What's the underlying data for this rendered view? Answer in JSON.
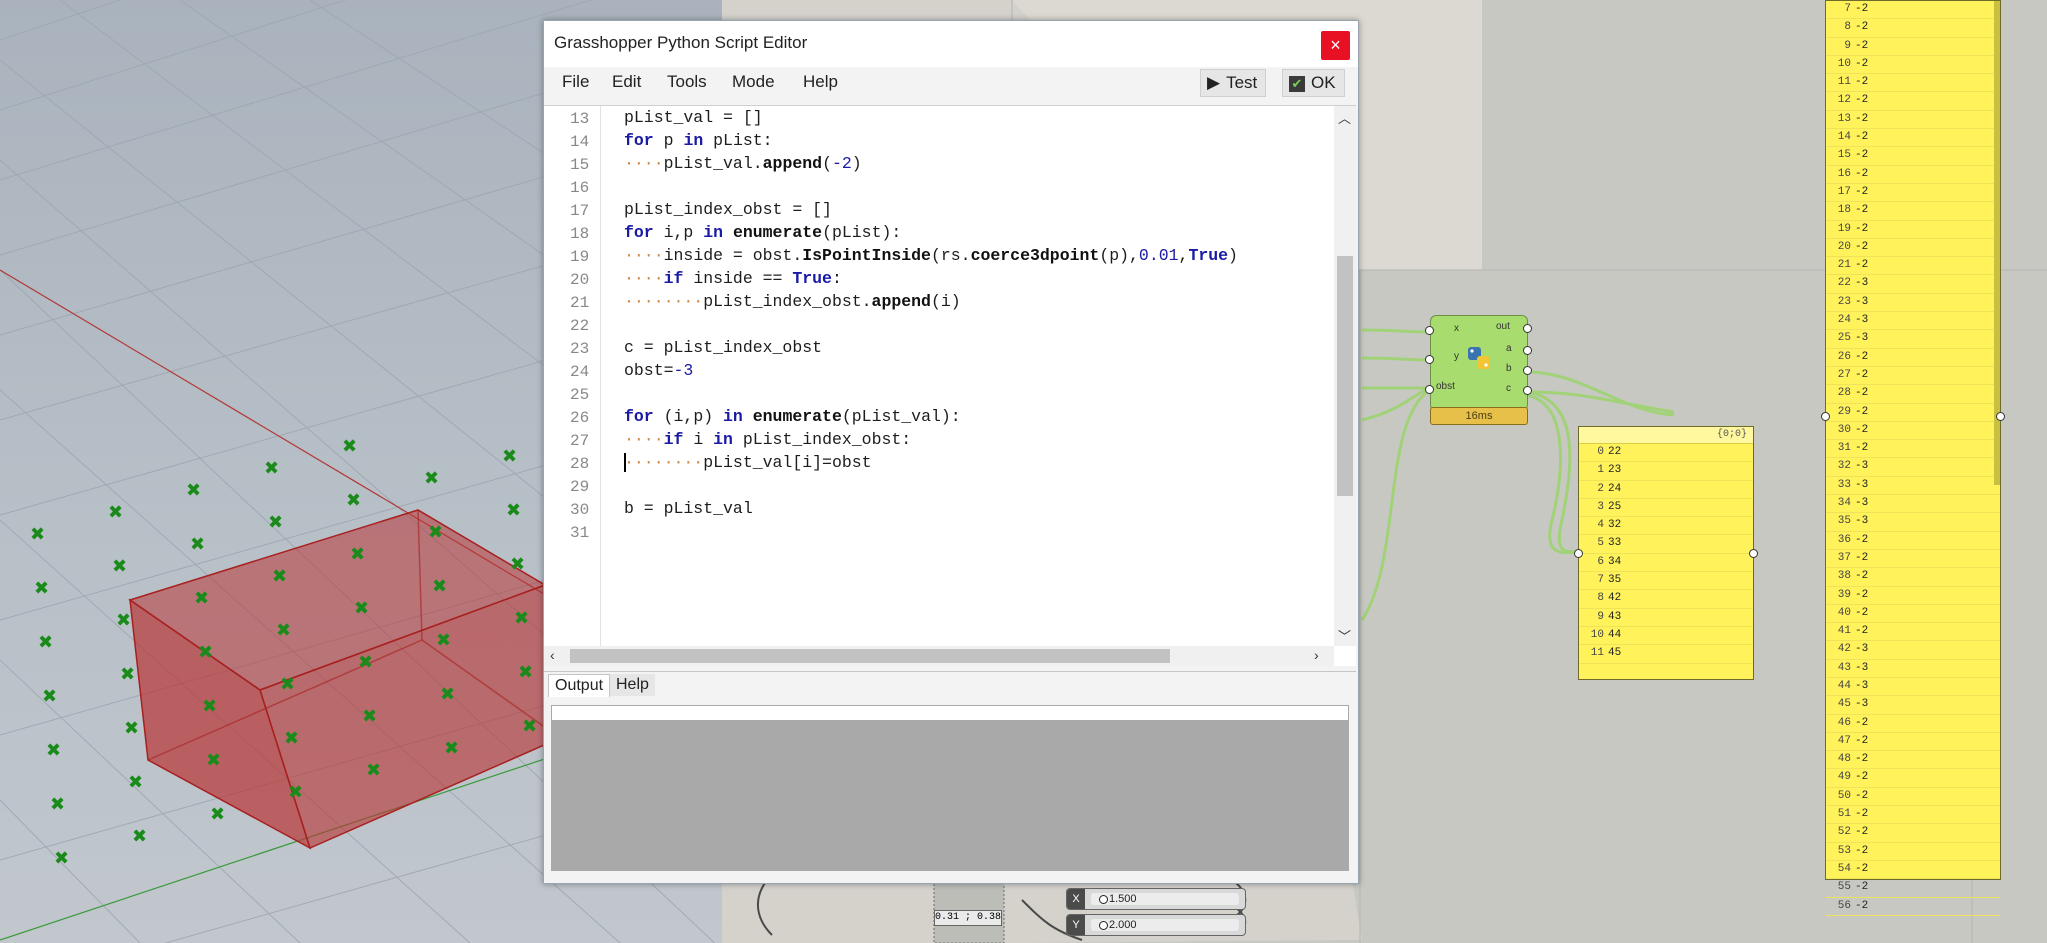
{
  "editor": {
    "title": "Grasshopper Python Script Editor",
    "close_icon": "×",
    "menus": [
      "File",
      "Edit",
      "Tools",
      "Mode",
      "Help"
    ],
    "test_label": "Test",
    "ok_label": "OK",
    "line_numbers": [
      "13",
      "14",
      "15",
      "16",
      "17",
      "18",
      "19",
      "20",
      "21",
      "22",
      "23",
      "24",
      "25",
      "26",
      "27",
      "28",
      "29",
      "30",
      "31"
    ],
    "output_tab": "Output",
    "help_tab": "Help"
  },
  "code_lines": [
    "pList_val = []",
    "for p in pList:",
    "····pList_val.append(-2)",
    "",
    "pList_index_obst = []",
    "for i,p in enumerate(pList):",
    "····inside = obst.IsPointInside(rs.coerce3dpoint(p),0.01,True)",
    "····if inside == True:",
    "········pList_index_obst.append(i)",
    "",
    "c = pList_index_obst",
    "obst=-3",
    "",
    "for (i,p) in enumerate(pList_val):",
    "····if i in pList_index_obst:",
    "········pList_val[i]=obst",
    "",
    "b = pList_val",
    ""
  ],
  "component": {
    "inputs": [
      "x",
      "y",
      "obst"
    ],
    "outputs": [
      "out",
      "a",
      "b",
      "c"
    ],
    "time": "16ms",
    "icon": "python-icon"
  },
  "panel_index": {
    "header": "{0;0}",
    "rows": [
      [
        "0",
        "22"
      ],
      [
        "1",
        "23"
      ],
      [
        "2",
        "24"
      ],
      [
        "3",
        "25"
      ],
      [
        "4",
        "32"
      ],
      [
        "5",
        "33"
      ],
      [
        "6",
        "34"
      ],
      [
        "7",
        "35"
      ],
      [
        "8",
        "42"
      ],
      [
        "9",
        "43"
      ],
      [
        "10",
        "44"
      ],
      [
        "11",
        "45"
      ]
    ]
  },
  "panel_values": {
    "rows": [
      [
        "7",
        "-2"
      ],
      [
        "8",
        "-2"
      ],
      [
        "9",
        "-2"
      ],
      [
        "10",
        "-2"
      ],
      [
        "11",
        "-2"
      ],
      [
        "12",
        "-2"
      ],
      [
        "13",
        "-2"
      ],
      [
        "14",
        "-2"
      ],
      [
        "15",
        "-2"
      ],
      [
        "16",
        "-2"
      ],
      [
        "17",
        "-2"
      ],
      [
        "18",
        "-2"
      ],
      [
        "19",
        "-2"
      ],
      [
        "20",
        "-2"
      ],
      [
        "21",
        "-2"
      ],
      [
        "22",
        "-3"
      ],
      [
        "23",
        "-3"
      ],
      [
        "24",
        "-3"
      ],
      [
        "25",
        "-3"
      ],
      [
        "26",
        "-2"
      ],
      [
        "27",
        "-2"
      ],
      [
        "28",
        "-2"
      ],
      [
        "29",
        "-2"
      ],
      [
        "30",
        "-2"
      ],
      [
        "31",
        "-2"
      ],
      [
        "32",
        "-3"
      ],
      [
        "33",
        "-3"
      ],
      [
        "34",
        "-3"
      ],
      [
        "35",
        "-3"
      ],
      [
        "36",
        "-2"
      ],
      [
        "37",
        "-2"
      ],
      [
        "38",
        "-2"
      ],
      [
        "39",
        "-2"
      ],
      [
        "40",
        "-2"
      ],
      [
        "41",
        "-2"
      ],
      [
        "42",
        "-3"
      ],
      [
        "43",
        "-3"
      ],
      [
        "44",
        "-3"
      ],
      [
        "45",
        "-3"
      ],
      [
        "46",
        "-2"
      ],
      [
        "47",
        "-2"
      ],
      [
        "48",
        "-2"
      ],
      [
        "49",
        "-2"
      ],
      [
        "50",
        "-2"
      ],
      [
        "51",
        "-2"
      ],
      [
        "52",
        "-2"
      ],
      [
        "53",
        "-2"
      ],
      [
        "54",
        "-2"
      ],
      [
        "55",
        "-2"
      ],
      [
        "56",
        "-2"
      ]
    ]
  },
  "sliders": [
    {
      "label": "X",
      "value": "1.500"
    },
    {
      "label": "Y",
      "value": "2.000"
    }
  ],
  "small_readout": "0.31 ; 0.38",
  "colors": {
    "close": "#e81123",
    "keyword": "#1a1aa6",
    "panel": "#fff25a",
    "component": "#a8dc6e",
    "box": "#b83434",
    "point": "#1a8a1a"
  }
}
